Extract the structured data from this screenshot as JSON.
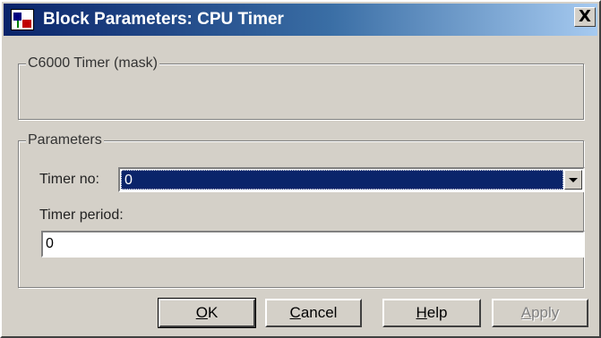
{
  "window": {
    "title": "Block Parameters: CPU Timer",
    "close_glyph": "X"
  },
  "mask_group": {
    "legend": "C6000 Timer (mask)"
  },
  "parameters": {
    "legend": "Parameters",
    "timer_no": {
      "label": "Timer no:",
      "value": "0"
    },
    "timer_period": {
      "label": "Timer period:",
      "value": "0"
    }
  },
  "buttons": {
    "ok": {
      "mnemonic": "O",
      "rest": "K"
    },
    "cancel": {
      "mnemonic": "C",
      "rest": "ancel"
    },
    "help": {
      "mnemonic": "H",
      "rest": "elp"
    },
    "apply": {
      "mnemonic": "A",
      "rest": "pply"
    }
  },
  "icons": {
    "app": "simulink-block-icon",
    "close": "close-icon",
    "dropdown": "chevron-down-icon"
  }
}
